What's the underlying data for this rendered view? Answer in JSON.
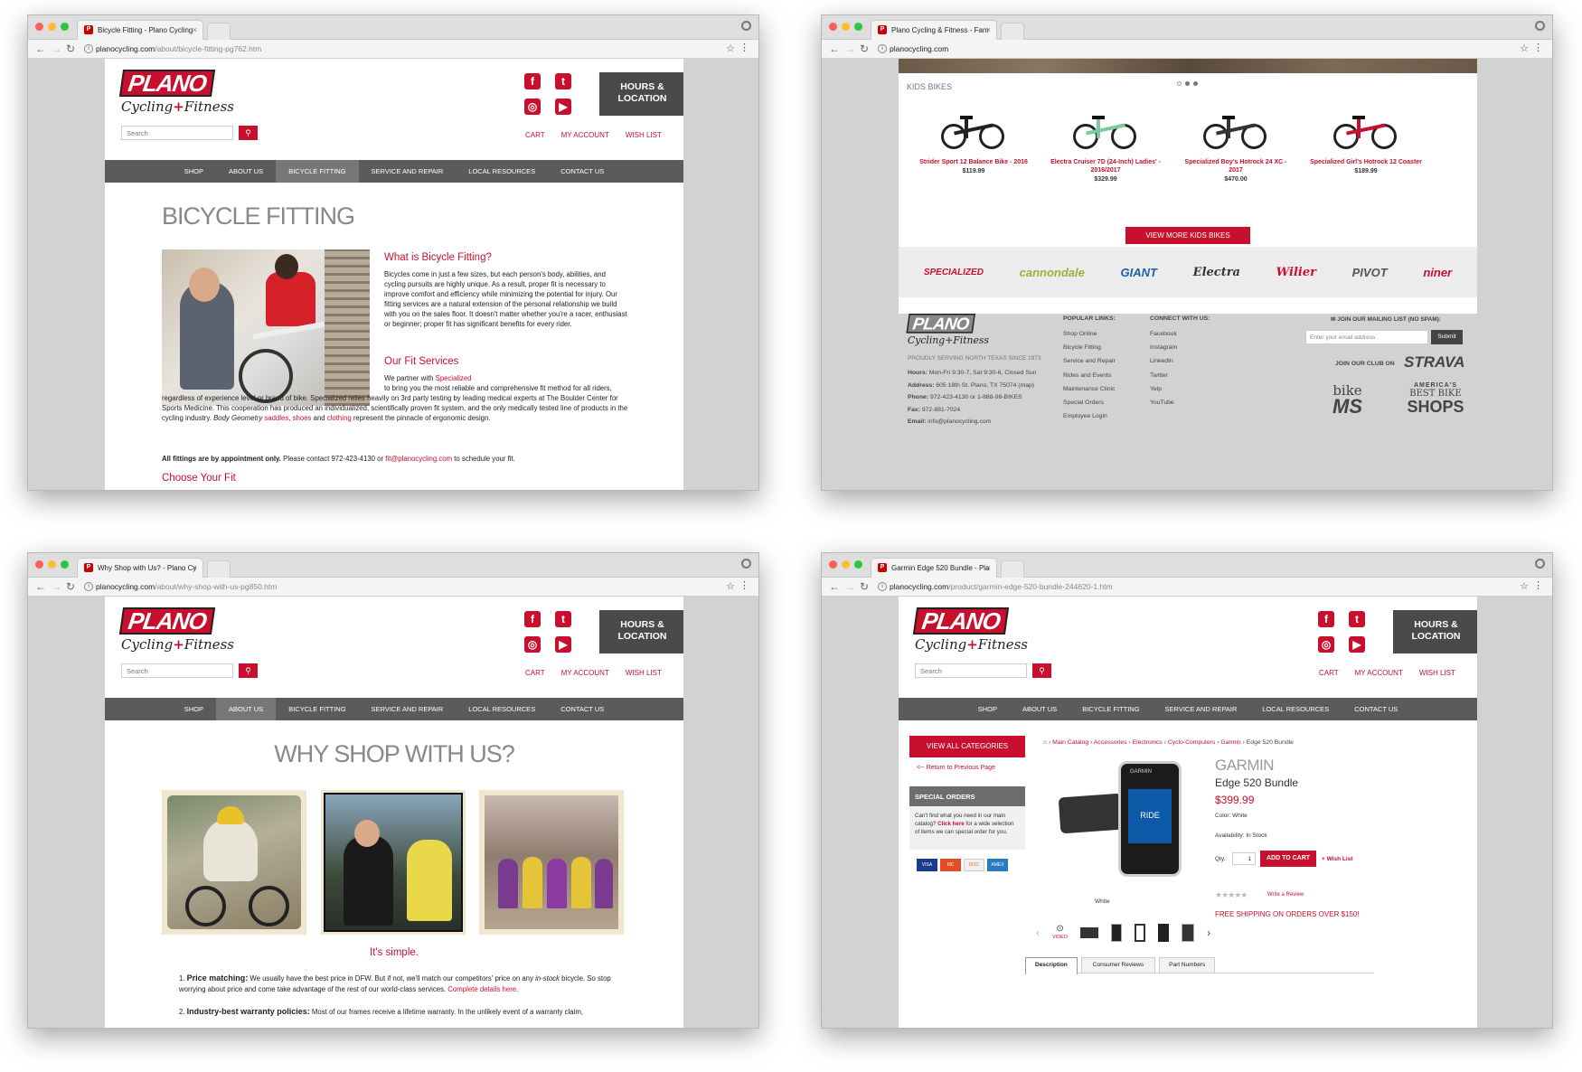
{
  "w1": {
    "tab": "Bicycle Fitting - Plano Cycling",
    "url_domain": "planocycling.com",
    "url_path": "/about/bicycle-fitting-pg762.htm",
    "title": "BICYCLE FITTING",
    "h1": "What is Bicycle Fitting?",
    "p1": "Bicycles come in just a few sizes, but each person's body, abilities, and cycling pursuits are highly unique. As a result, proper fit is necessary to improve comfort and efficiency while minimizing the potential for injury. Our fitting services are a natural extension of the personal relationship we build with you on the sales floor. It doesn't matter whether you're a racer, enthusiast or beginner; proper fit has significant benefits for every rider.",
    "h2": "Our Fit Services",
    "p2a": "We partner with ",
    "p2link": "Specialized",
    "p2b": " to bring you the most reliable and comprehensive fit method for all riders, regardless of experience level or brand of bike. Specialized relies heavily on 3rd party testing by leading medical experts at The Boulder Center for Sports Medicine. This cooperation has produced an individualized, scientifically proven fit system, and the only medically tested line of products in the cycling industry. ",
    "p2em": "Body Geometry",
    "p2l1": "saddles",
    "p2l2": "shoes",
    "p2l3": "clothing",
    "p2c": " represent the pinnacle of ergonomic design.",
    "p3bold": "All fittings are by appointment only.",
    "p3a": " Please contact 972-423-4130 or ",
    "p3email": "fit@planocycling.com",
    "p3b": " to schedule your fit.",
    "h3": "Choose Your Fit"
  },
  "header": {
    "logo_top": "PLANO",
    "logo_bottom_a": "Cycling",
    "logo_plus": "+",
    "logo_bottom_b": "Fitness",
    "hours": "HOURS & LOCATION",
    "search_placeholder": "Search",
    "cart": "CART",
    "account": "MY ACCOUNT",
    "wishlist": "WISH LIST",
    "social": [
      "f",
      "t",
      "◎",
      "▶"
    ]
  },
  "nav": [
    "SHOP",
    "ABOUT US",
    "BICYCLE FITTING",
    "SERVICE AND REPAIR",
    "LOCAL RESOURCES",
    "CONTACT US"
  ],
  "w2": {
    "tab": "Plano Cycling & Fitness - Fam",
    "url_domain": "planocycling.com",
    "section": "KIDS BIKES",
    "products": [
      {
        "name": "Strider Sport 12 Balance Bike - 2016",
        "price": "$119.99",
        "color": "#222"
      },
      {
        "name": "Electra Cruiser 7D (24-Inch) Ladies' - 2016/2017",
        "price": "$329.99",
        "color": "#7cc9a0"
      },
      {
        "name": "Specialized Boy's Hotrock 24 XC - 2017",
        "price": "$470.00",
        "color": "#333"
      },
      {
        "name": "Specialized Girl's Hotrock 12 Coaster",
        "price": "$189.99",
        "color": "#c8102e"
      }
    ],
    "view_more": "VIEW MORE KIDS BIKES",
    "brands": [
      "SPECIALIZED",
      "cannondale",
      "GIANT",
      "Electra",
      "Wilier",
      "PIVOT",
      "niner"
    ],
    "serving": "PROUDLY SERVING NORTH TEXAS SINCE 1973",
    "hours_l": "Hours:",
    "hours_v": "Mon-Fri 9:30-7, Sat 9:30-6, Closed Sun",
    "address_l": "Address:",
    "address_v": "605 18th St. Plano, TX 75074 (map)",
    "phone_l": "Phone:",
    "phone_v": "972-423-4130 or 1-888-98-BIKES",
    "fax_l": "Fax:",
    "fax_v": "972-881-7024",
    "email_l": "Email:",
    "email_v": "info@planocycling.com",
    "popular_h": "POPULAR LINKS:",
    "popular": [
      "Shop Online",
      "Bicycle Fitting",
      "Service and Repair",
      "Rides and Events",
      "Maintenance Clinic",
      "Special Orders",
      "Employee Login"
    ],
    "connect_h": "CONNECT WITH US:",
    "connect": [
      "Facebook",
      "Instagram",
      "LinkedIn",
      "Twitter",
      "Yelp",
      "YouTube"
    ],
    "mailing": "JOIN OUR MAILING LIST (NO SPAM):",
    "email_ph": "Enter your email address",
    "submit": "Submit",
    "club": "JOIN OUR CLUB ON",
    "strava": "STRAVA",
    "bikems_a": "bike",
    "bikems_b": "MS",
    "abbs_a": "AMERICA'S",
    "abbs_b": "BEST BIKE",
    "abbs_c": "SHOPS"
  },
  "w3": {
    "tab": "Why Shop with Us? - Plano Cy",
    "url_domain": "planocycling.com",
    "url_path": "/about/why-shop-with-us-pg850.htm",
    "title": "WHY SHOP WITH US?",
    "simple": "It's simple.",
    "i1b": "Price matching:",
    "i1a": " We usually have the best price in DFW. But if not, we'll match our competitors' price on any ",
    "i1em": "in-stock",
    "i1c": " bicycle. So stop worrying about price and come take advantage of the rest of our world-class services. ",
    "i1link": "Complete details here.",
    "i2b": "Industry-best warranty policies:",
    "i2a": " Most of our frames receive a lifetime warranty. In the unlikely event of a warranty claim,"
  },
  "w4": {
    "tab": "Garmin Edge 520 Bundle - Pla",
    "url_domain": "planocycling.com",
    "url_path": "/product/garmin-edge-520-bundle-244620-1.htm",
    "view_all": "VIEW ALL CATEGORIES",
    "return": "<-- Return to Previous Page",
    "special_h": "SPECIAL ORDERS",
    "special_a": "Can't find what you need in our main catalog? ",
    "special_link": "Click here",
    "special_b": " for a wide selection of items we can special order for you.",
    "cards": [
      "VISA",
      "MC",
      "DISC",
      "AMEX"
    ],
    "crumbs": [
      "Main Catalog",
      "Accessories",
      "Electronics",
      "Cyclo-Computers",
      "Garmin"
    ],
    "crumb_last": "Edge 520 Bundle",
    "brand": "GARMIN",
    "name": "Edge 520 Bundle",
    "price": "$399.99",
    "color": "Color: White",
    "avail": "Availability: In Stock",
    "qty_l": "Qty.:",
    "qty": "1",
    "add": "ADD TO CART",
    "wish": "+ Wish List",
    "review": "Write a Review",
    "ship": "FREE SHIPPING ON ORDERS OVER $150!",
    "caption": "White",
    "video": "VIDEO",
    "device_brand": "GARMIN",
    "device_screen": "RIDE",
    "tabs": [
      "Description",
      "Consumer Reviews",
      "Part Numbers"
    ]
  }
}
